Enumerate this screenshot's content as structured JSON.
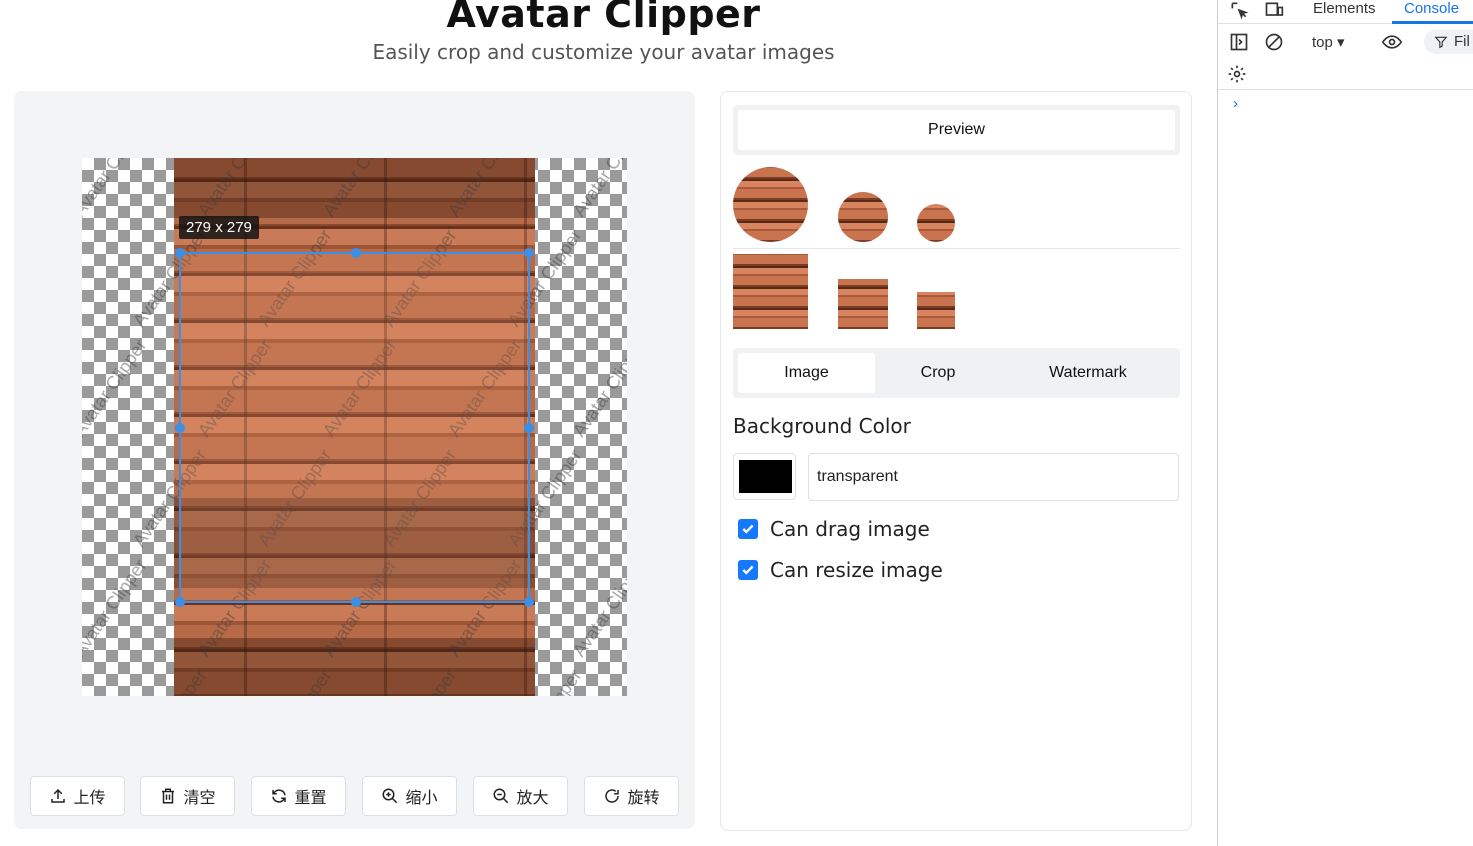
{
  "header": {
    "title": "Avatar Clipper",
    "subtitle": "Easily crop and customize your avatar images"
  },
  "editor": {
    "watermark_text": "Avatar Clipper",
    "crop_size_label": "279 x 279",
    "buttons": [
      {
        "id": "upload",
        "label": "上传",
        "icon": "upload-icon"
      },
      {
        "id": "clear",
        "label": "清空",
        "icon": "trash-icon"
      },
      {
        "id": "reset",
        "label": "重置",
        "icon": "refresh-icon"
      },
      {
        "id": "zoom-out",
        "label": "缩小",
        "icon": "zoom-in-icon"
      },
      {
        "id": "zoom-in",
        "label": "放大",
        "icon": "zoom-out-icon"
      },
      {
        "id": "rotate",
        "label": "旋转",
        "icon": "rotate-icon"
      }
    ]
  },
  "panel": {
    "preview_tab": "Preview",
    "tabs": [
      "Image",
      "Crop",
      "Watermark"
    ],
    "active_tab": "Image",
    "background_color_label": "Background Color",
    "background_color_value": "transparent",
    "swatch_color": "#000000",
    "can_drag_label": "Can drag image",
    "can_drag_checked": true,
    "can_resize_label": "Can resize image",
    "can_resize_checked": true
  },
  "devtools": {
    "tabs": [
      "Elements",
      "Console"
    ],
    "active_tab": "Console",
    "context": "top",
    "filter_label": "Fil",
    "prompt": "›"
  },
  "colors": {
    "accent": "#3b8fe4",
    "checkbox": "#1677ff",
    "devtools_active": "#1a73e8"
  }
}
